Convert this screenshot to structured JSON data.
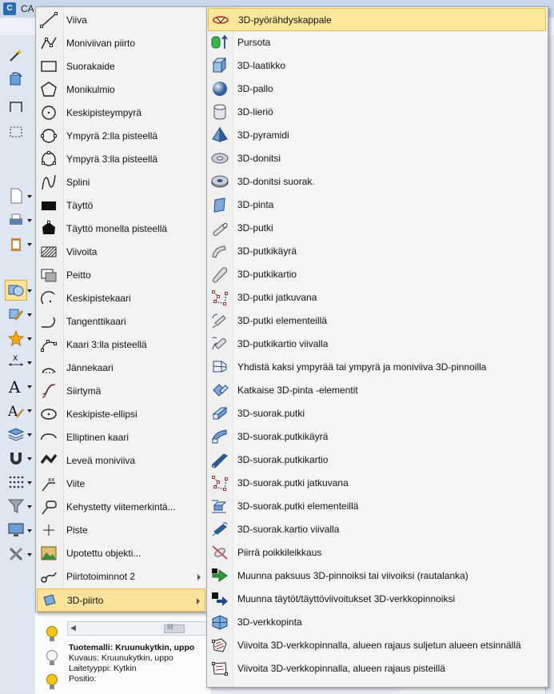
{
  "app": {
    "title": "CA",
    "menu_text": "I",
    "bottom_panel": {
      "model_label": "Tuotemalli: Kruunukytkin, uppo",
      "description": "Kuvaus: Kruunukytkin, uppo",
      "device_type": "Laitetyyppi: Kytkin",
      "position": "Positio:",
      "scroll_glyph": "III"
    }
  },
  "menu_left": {
    "items": [
      {
        "label": "Viiva",
        "icon": "line-icon"
      },
      {
        "label": "Moniviivan piirto",
        "icon": "polyline-icon"
      },
      {
        "label": "Suorakaide",
        "icon": "rectangle-icon"
      },
      {
        "label": "Monikulmio",
        "icon": "polygon-icon"
      },
      {
        "label": "Keskipisteympyrä",
        "icon": "center-circle-icon"
      },
      {
        "label": "Ympyrä 2:lla pisteellä",
        "icon": "circle-2pt-icon"
      },
      {
        "label": "Ympyrä 3:lla pisteellä",
        "icon": "circle-3pt-icon"
      },
      {
        "label": "Splini",
        "icon": "spline-icon"
      },
      {
        "label": "Täyttö",
        "icon": "fill-icon"
      },
      {
        "label": "Täyttö monella pisteellä",
        "icon": "fill-multipoint-icon"
      },
      {
        "label": "Viivoita",
        "icon": "hatch-icon"
      },
      {
        "label": "Peitto",
        "icon": "mask-icon"
      },
      {
        "label": "Keskipistekaari",
        "icon": "center-arc-icon"
      },
      {
        "label": "Tangenttikaari",
        "icon": "tangent-arc-icon"
      },
      {
        "label": "Kaari 3:lla pisteellä",
        "icon": "arc-3pt-icon"
      },
      {
        "label": "Jännekaari",
        "icon": "chord-arc-icon"
      },
      {
        "label": "Siirtymä",
        "icon": "transition-icon"
      },
      {
        "label": "Keskipiste-ellipsi",
        "icon": "center-ellipse-icon"
      },
      {
        "label": "Elliptinen kaari",
        "icon": "elliptic-arc-icon"
      },
      {
        "label": "Leveä moniviiva",
        "icon": "wide-polyline-icon"
      },
      {
        "label": "Viite",
        "icon": "reference-icon"
      },
      {
        "label": "Kehystetty viitemerkintä...",
        "icon": "framed-reference-icon"
      },
      {
        "label": "Piste",
        "icon": "point-icon"
      },
      {
        "label": "Upotettu objekti...",
        "icon": "embedded-object-icon"
      },
      {
        "label": "Piirtotoiminnot 2",
        "icon": "drawing-functions-icon",
        "submenu": true
      },
      {
        "label": "3D-piirto",
        "icon": "3d-drawing-icon",
        "submenu": true,
        "highlighted": true
      }
    ]
  },
  "menu_right": {
    "items": [
      {
        "label": "3D-pyörähdyskappale",
        "icon": "3d-revolve-icon",
        "highlighted": true
      },
      {
        "label": "Pursota",
        "icon": "extrude-icon"
      },
      {
        "label": "3D-laatikko",
        "icon": "3d-box-icon"
      },
      {
        "label": "3D-pallo",
        "icon": "3d-sphere-icon"
      },
      {
        "label": "3D-lieriö",
        "icon": "3d-cylinder-icon"
      },
      {
        "label": "3D-pyramidi",
        "icon": "3d-pyramid-icon"
      },
      {
        "label": "3D-donitsi",
        "icon": "3d-torus-icon"
      },
      {
        "label": "3D-donitsi suorak.",
        "icon": "3d-torus-rect-icon"
      },
      {
        "label": "3D-pinta",
        "icon": "3d-surface-icon"
      },
      {
        "label": "3D-putki",
        "icon": "3d-pipe-icon"
      },
      {
        "label": "3D-putkikäyrä",
        "icon": "3d-pipe-bend-icon"
      },
      {
        "label": "3D-putkikartio",
        "icon": "3d-pipe-cone-icon"
      },
      {
        "label": "3D-putki jatkuvana",
        "icon": "3d-pipe-continuous-icon"
      },
      {
        "label": "3D-putki elementeillä",
        "icon": "3d-pipe-elements-icon"
      },
      {
        "label": "3D-putkikartio viivalla",
        "icon": "3d-pipe-cone-line-icon"
      },
      {
        "label": "Yhdistä kaksi ympyrää tai ympyrä ja moniviiva 3D-pinnoilla",
        "icon": "join-circles-icon"
      },
      {
        "label": "Katkaise 3D-pinta -elementit",
        "icon": "cut-surface-icon"
      },
      {
        "label": "3D-suorak.putki",
        "icon": "3d-rect-pipe-icon"
      },
      {
        "label": "3D-suorak.putkikäyrä",
        "icon": "3d-rect-pipe-bend-icon"
      },
      {
        "label": "3D-suorak.putkikartio",
        "icon": "3d-rect-pipe-cone-icon"
      },
      {
        "label": "3D-suorak.putki jatkuvana",
        "icon": "3d-rect-pipe-continuous-icon"
      },
      {
        "label": "3D-suorak.putki elementeillä",
        "icon": "3d-rect-pipe-elements-icon"
      },
      {
        "label": "3D-suorak.kartio viivalla",
        "icon": "3d-rect-cone-line-icon"
      },
      {
        "label": "Piirrä poikkileikkaus",
        "icon": "cross-section-icon"
      },
      {
        "label": "Muunna paksuus 3D-pinnoiksi tai viivoiksi (rautalanka)",
        "icon": "thickness-convert-icon"
      },
      {
        "label": "Muunna täytöt/täyttöviivoitukset 3D-verkkopinnoiksi",
        "icon": "fill-convert-icon"
      },
      {
        "label": "3D-verkkopinta",
        "icon": "3d-mesh-icon"
      },
      {
        "label": "Viivoita 3D-verkkopinnalla, alueen rajaus suljetun alueen etsinnällä",
        "icon": "hatch-mesh-closed-icon"
      },
      {
        "label": "Viivoita 3D-verkkopinnalla, alueen rajaus pisteillä",
        "icon": "hatch-mesh-points-icon"
      }
    ]
  }
}
